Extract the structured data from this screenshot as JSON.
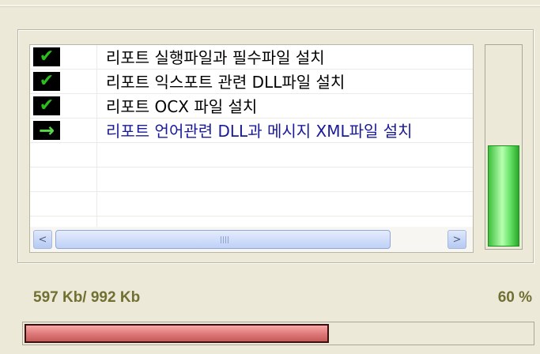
{
  "install_steps": [
    {
      "status": "done",
      "icon": "check-icon",
      "glyph": "✔",
      "label": "리포트 실행파일과 필수파일 설치"
    },
    {
      "status": "done",
      "icon": "check-icon",
      "glyph": "✔",
      "label": "리포트 익스포트 관련 DLL파일 설치"
    },
    {
      "status": "done",
      "icon": "check-icon",
      "glyph": "✔",
      "label": "리포트 OCX 파일 설치"
    },
    {
      "status": "current",
      "icon": "arrow-right-icon",
      "glyph": "→",
      "label": "리포트 언어관련 DLL과 메시지 XML파일 설치"
    }
  ],
  "scrollbar": {
    "left_arrow": "<",
    "right_arrow": ">"
  },
  "overall_progress": {
    "fraction": 0.5
  },
  "download": {
    "size_text": "597 Kb/ 992 Kb",
    "percent_text": "60 %",
    "fraction": 0.6
  },
  "colors": {
    "done_icon": "#2bbf1e",
    "current_label": "#1a1a99",
    "vertical_bar": "#6ae46a",
    "horizontal_bar": "#e07a7a",
    "size_text": "#707032"
  }
}
